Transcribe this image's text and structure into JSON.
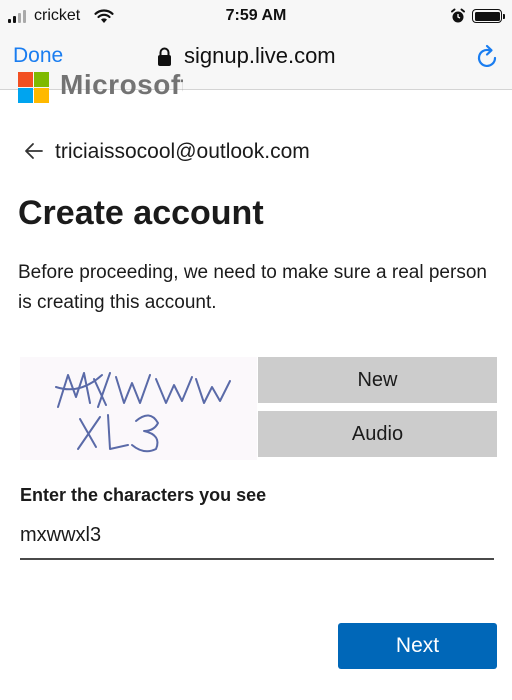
{
  "status_bar": {
    "carrier": "cricket",
    "time": "7:59 AM"
  },
  "browser": {
    "done_label": "Done",
    "url": "signup.live.com"
  },
  "page": {
    "logo_text": "Microsoft",
    "identity": "triciaissocool@outlook.com",
    "title": "Create account",
    "description": "Before proceeding, we need to make sure a real person is creating this account.",
    "captcha": {
      "image_text": "MXWW XL3",
      "new_label": "New",
      "audio_label": "Audio"
    },
    "input_label": "Enter the characters you see",
    "input_value": "mxwwxl3",
    "next_label": "Next"
  },
  "colors": {
    "accent": "#0067b8",
    "ios_blue": "#1a7df0",
    "captcha_ink": "#5a6aa8"
  }
}
